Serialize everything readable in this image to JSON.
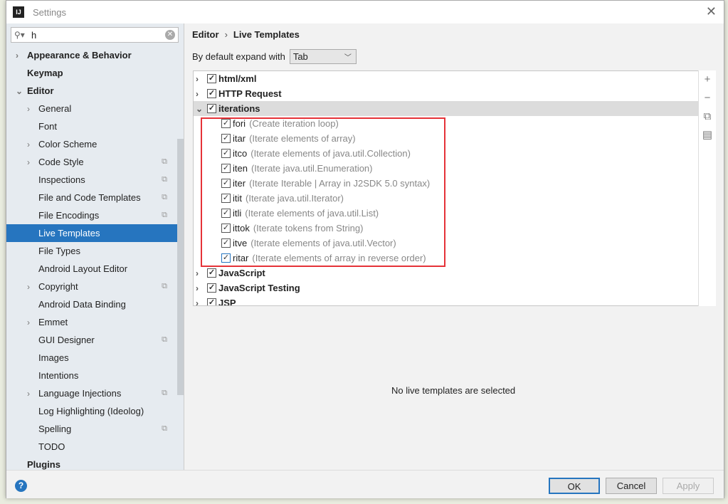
{
  "window": {
    "title": "Settings"
  },
  "search": {
    "value": "h"
  },
  "sidebar": {
    "items": [
      {
        "label": "Appearance & Behavior",
        "level": 0,
        "bold": true,
        "arrow": "right"
      },
      {
        "label": "Keymap",
        "level": 0,
        "bold": true
      },
      {
        "label": "Editor",
        "level": 0,
        "bold": true,
        "arrow": "down"
      },
      {
        "label": "General",
        "level": 1,
        "arrow": "right"
      },
      {
        "label": "Font",
        "level": 1
      },
      {
        "label": "Color Scheme",
        "level": 1,
        "arrow": "right"
      },
      {
        "label": "Code Style",
        "level": 1,
        "arrow": "right",
        "copy": true
      },
      {
        "label": "Inspections",
        "level": 1,
        "copy": true
      },
      {
        "label": "File and Code Templates",
        "level": 1,
        "copy": true
      },
      {
        "label": "File Encodings",
        "level": 1,
        "copy": true
      },
      {
        "label": "Live Templates",
        "level": 1,
        "selected": true
      },
      {
        "label": "File Types",
        "level": 1
      },
      {
        "label": "Android Layout Editor",
        "level": 1
      },
      {
        "label": "Copyright",
        "level": 1,
        "arrow": "right",
        "copy": true
      },
      {
        "label": "Android Data Binding",
        "level": 1
      },
      {
        "label": "Emmet",
        "level": 1,
        "arrow": "right"
      },
      {
        "label": "GUI Designer",
        "level": 1,
        "copy": true
      },
      {
        "label": "Images",
        "level": 1
      },
      {
        "label": "Intentions",
        "level": 1
      },
      {
        "label": "Language Injections",
        "level": 1,
        "arrow": "right",
        "copy": true
      },
      {
        "label": "Log Highlighting (Ideolog)",
        "level": 1
      },
      {
        "label": "Spelling",
        "level": 1,
        "copy": true
      },
      {
        "label": "TODO",
        "level": 1
      },
      {
        "label": "Plugins",
        "level": 0,
        "bold": true
      }
    ]
  },
  "breadcrumb": {
    "parent": "Editor",
    "current": "Live Templates"
  },
  "expand": {
    "label": "By default expand with",
    "value": "Tab"
  },
  "tree": [
    {
      "name": "html/xml",
      "group": true,
      "arrow": "right"
    },
    {
      "name": "HTTP Request",
      "group": true,
      "arrow": "right"
    },
    {
      "name": "iterations",
      "group": true,
      "arrow": "down",
      "highlight": true
    },
    {
      "name": "fori",
      "desc": "(Create iteration loop)"
    },
    {
      "name": "itar",
      "desc": "(Iterate elements of array)"
    },
    {
      "name": "itco",
      "desc": "(Iterate elements of java.util.Collection)"
    },
    {
      "name": "iten",
      "desc": "(Iterate java.util.Enumeration)"
    },
    {
      "name": "iter",
      "desc": "(Iterate Iterable | Array in J2SDK 5.0 syntax)"
    },
    {
      "name": "itit",
      "desc": "(Iterate java.util.Iterator)"
    },
    {
      "name": "itli",
      "desc": "(Iterate elements of java.util.List)"
    },
    {
      "name": "ittok",
      "desc": "(Iterate tokens from String)"
    },
    {
      "name": "itve",
      "desc": "(Iterate elements of java.util.Vector)"
    },
    {
      "name": "ritar",
      "desc": "(Iterate elements of array in reverse order)",
      "focused": true
    },
    {
      "name": "JavaScript",
      "group": true,
      "arrow": "right"
    },
    {
      "name": "JavaScript Testing",
      "group": true,
      "arrow": "right"
    },
    {
      "name": "JSP",
      "group": true,
      "arrow": "right"
    }
  ],
  "tools": [
    "add-icon",
    "remove-icon",
    "copy-icon",
    "edit-icon"
  ],
  "empty_message": "No live templates are selected",
  "footer": {
    "ok": "OK",
    "cancel": "Cancel",
    "apply": "Apply",
    "help": "?"
  },
  "colors": {
    "accent": "#2675bf",
    "highlight_box": "#e53238"
  }
}
